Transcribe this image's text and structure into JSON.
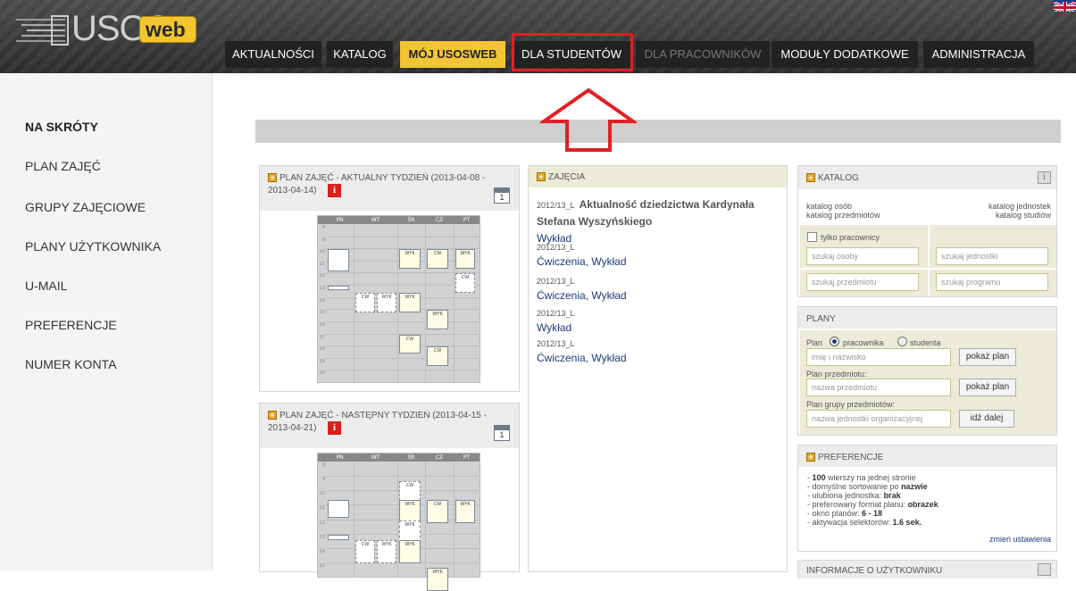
{
  "header": {
    "logo": {
      "brand": "USOS",
      "web": "web"
    },
    "flag_icon": "uk-flag-icon",
    "tabs": [
      {
        "label": "AKTUALNOŚCI",
        "state": "normal"
      },
      {
        "label": "KATALOG",
        "state": "normal"
      },
      {
        "label": "MÓJ USOSWEB",
        "state": "active"
      },
      {
        "label": "DLA STUDENTÓW",
        "state": "highlighted"
      },
      {
        "label": "DLA PRACOWNIKÓW",
        "state": "disabled"
      },
      {
        "label": "MODUŁY DODATKOWE",
        "state": "normal"
      },
      {
        "label": "ADMINISTRACJA",
        "state": "normal"
      }
    ]
  },
  "sidebar": {
    "heading": "NA SKRÓTY",
    "items": [
      "PLAN ZAJĘĆ",
      "GRUPY ZAJĘCIOWE",
      "PLANY UŻYTKOWNIKA",
      "U-MAIL",
      "PREFERENCJE",
      "NUMER KONTA"
    ]
  },
  "plan_current": {
    "title": "PLAN ZAJĘĆ - AKTUALNY TYDZIEŃ (2013-04-08 -",
    "title2": "2013-04-14)",
    "info_icon": "i",
    "calendar_day": "1",
    "days": [
      "PN",
      "WT",
      "ŚR",
      "CZ",
      "PT"
    ],
    "hours": [
      "8",
      "9",
      "10",
      "11",
      "12",
      "13",
      "14",
      "15",
      "16",
      "17",
      "18",
      "19",
      "20"
    ],
    "events": [
      "WYK",
      "CW",
      "WYK",
      "CW",
      "CW",
      "WYK",
      "WYK",
      "WYK",
      "CW",
      "CW"
    ]
  },
  "plan_next": {
    "title": "PLAN ZAJĘĆ - NASTĘPNY TYDZIEŃ (2013-04-15 -",
    "title2": "2013-04-21)",
    "info_icon": "i",
    "calendar_day": "1",
    "days": [
      "PN",
      "WT",
      "ŚR",
      "CZ",
      "PT"
    ],
    "hours": [
      "8",
      "9",
      "10",
      "11",
      "12",
      "13",
      "14",
      "15"
    ],
    "events": [
      "CW",
      "WYK",
      "CW",
      "WYK",
      "WYK",
      "CW",
      "WYK",
      "WYK",
      "WYK"
    ]
  },
  "zajecia": {
    "heading": "ZAJĘCIA",
    "items": [
      {
        "semester": "2012/13_L",
        "title": "Aktualność dziedzictwa Kardynała Stefana Wyszyńskiego",
        "links": [
          "Wykład"
        ]
      },
      {
        "semester": "2012/13_L",
        "title": "",
        "links": [
          "Ćwiczenia",
          "Wykład"
        ]
      },
      {
        "semester": "2012/13_L",
        "title": "",
        "links": [
          "Ćwiczenia",
          "Wykład"
        ]
      },
      {
        "semester": "2012/13_L",
        "title": "",
        "links": [
          "Wykład"
        ]
      },
      {
        "semester": "2012/13_L",
        "title": "",
        "links": [
          "Ćwiczenia",
          "Wykład"
        ]
      }
    ]
  },
  "katalog": {
    "heading": "KATALOG",
    "info": "i",
    "links": {
      "osob": "katalog osób",
      "przedmiotow": "katalog przedmiotów",
      "jednostek": "katalog jednostek",
      "studiow": "katalog studiów"
    },
    "checkbox_label": "tylko pracownicy",
    "placeholders": {
      "osoby": "szukaj osoby",
      "jednostki": "szukaj jednostki",
      "przedmiotu": "szukaj przedmiotu",
      "programu": "szukaj programu"
    }
  },
  "plany": {
    "heading": "PLANY",
    "plan_label": "Plan",
    "radio_pracownika": "pracownika",
    "radio_studenta": "studenta",
    "name_placeholder": "imię i nazwisko",
    "show_button": "pokaż plan",
    "subject_label": "Plan przedmiotu:",
    "subject_placeholder": "nazwa przedmiotu",
    "show_button2": "pokaż plan",
    "group_label": "Plan grupy przedmiotów:",
    "group_placeholder": "nazwa jednostki organizacyjnej",
    "go_button": "idź dalej"
  },
  "preferencje": {
    "heading": "PREFERENCJE",
    "l1_val": "100",
    "l1_text": " wierszy na jednej stronie",
    "l2_text": "- domyślne sortowanie po ",
    "l2_val": "nazwie",
    "l3_text": "- ulubiona jednostka: ",
    "l3_val": "brak",
    "l4_text": "- preferowany format planu: ",
    "l4_val": "obrazek",
    "l5_text": "- okno planów: ",
    "l5_val": "6 - 18",
    "l6_text": "- aktywacja selektorów: ",
    "l6_val": "1.6 sek.",
    "change_link": "zmień ustawienia"
  },
  "next_box_heading": "INFORMACJE O UŻYTKOWNIKU"
}
